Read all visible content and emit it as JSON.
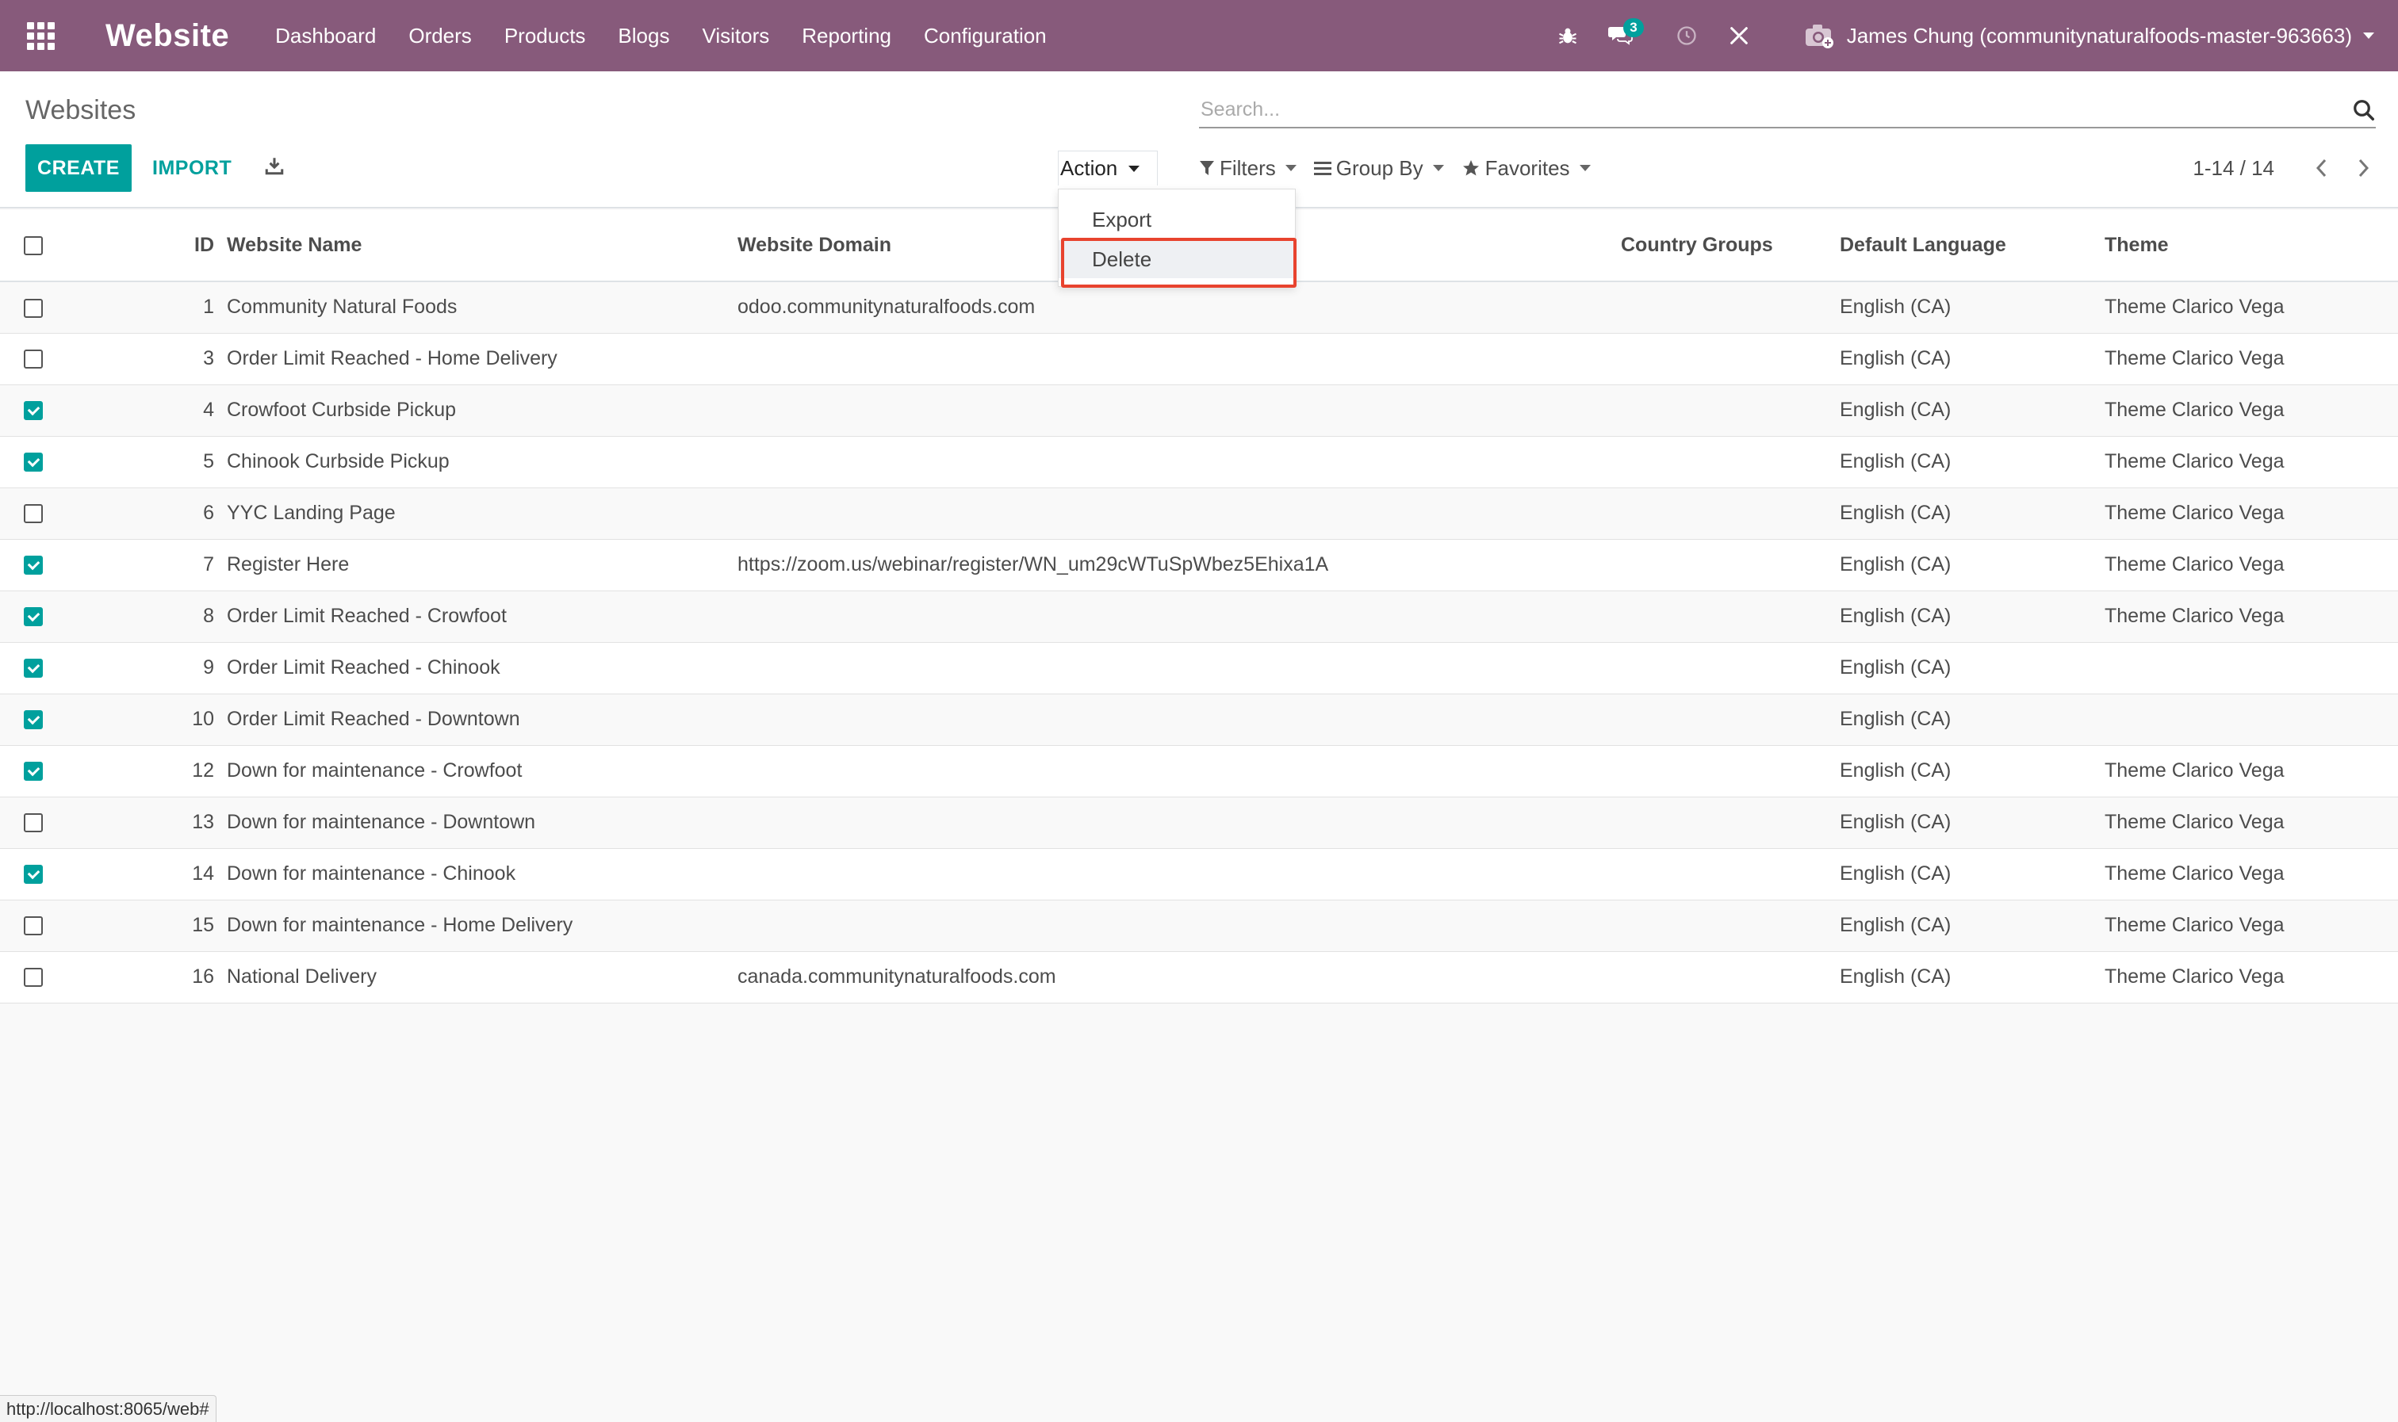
{
  "navbar": {
    "brand": "Website",
    "menu": [
      "Dashboard",
      "Orders",
      "Products",
      "Blogs",
      "Visitors",
      "Reporting",
      "Configuration"
    ],
    "messages_badge": "3",
    "user": "James Chung (communitynaturalfoods-master-963663)",
    "bg_color": "#875a7b"
  },
  "control": {
    "breadcrumb": "Websites",
    "search_placeholder": "Search...",
    "create_label": "CREATE",
    "import_label": "IMPORT",
    "action_label": "Action",
    "filters_label": "Filters",
    "groupby_label": "Group By",
    "favorites_label": "Favorites",
    "pager": "1-14 / 14"
  },
  "action_menu": {
    "items": [
      "Export",
      "Delete"
    ],
    "highlighted": "Delete"
  },
  "table": {
    "columns": [
      "ID",
      "Website Name",
      "Website Domain",
      "Country Groups",
      "Default Language",
      "Theme"
    ],
    "rows": [
      {
        "checked": false,
        "id": "1",
        "name": "Community Natural Foods",
        "domain": "odoo.communitynaturalfoods.com",
        "country": "",
        "lang": "English (CA)",
        "theme": "Theme Clarico Vega"
      },
      {
        "checked": false,
        "id": "3",
        "name": "Order Limit Reached - Home Delivery",
        "domain": "",
        "country": "",
        "lang": "English (CA)",
        "theme": "Theme Clarico Vega"
      },
      {
        "checked": true,
        "id": "4",
        "name": "Crowfoot Curbside Pickup",
        "domain": "",
        "country": "",
        "lang": "English (CA)",
        "theme": "Theme Clarico Vega"
      },
      {
        "checked": true,
        "id": "5",
        "name": "Chinook Curbside Pickup",
        "domain": "",
        "country": "",
        "lang": "English (CA)",
        "theme": "Theme Clarico Vega"
      },
      {
        "checked": false,
        "id": "6",
        "name": "YYC Landing Page",
        "domain": "",
        "country": "",
        "lang": "English (CA)",
        "theme": "Theme Clarico Vega"
      },
      {
        "checked": true,
        "id": "7",
        "name": "Register Here",
        "domain": "https://zoom.us/webinar/register/WN_um29cWTuSpWbez5Ehixa1A",
        "country": "",
        "lang": "English (CA)",
        "theme": "Theme Clarico Vega"
      },
      {
        "checked": true,
        "id": "8",
        "name": "Order Limit Reached - Crowfoot",
        "domain": "",
        "country": "",
        "lang": "English (CA)",
        "theme": "Theme Clarico Vega"
      },
      {
        "checked": true,
        "id": "9",
        "name": "Order Limit Reached - Chinook",
        "domain": "",
        "country": "",
        "lang": "English (CA)",
        "theme": ""
      },
      {
        "checked": true,
        "id": "10",
        "name": "Order Limit Reached - Downtown",
        "domain": "",
        "country": "",
        "lang": "English (CA)",
        "theme": ""
      },
      {
        "checked": true,
        "id": "12",
        "name": "Down for maintenance - Crowfoot",
        "domain": "",
        "country": "",
        "lang": "English (CA)",
        "theme": "Theme Clarico Vega"
      },
      {
        "checked": false,
        "id": "13",
        "name": "Down for maintenance - Downtown",
        "domain": "",
        "country": "",
        "lang": "English (CA)",
        "theme": "Theme Clarico Vega"
      },
      {
        "checked": true,
        "id": "14",
        "name": "Down for maintenance - Chinook",
        "domain": "",
        "country": "",
        "lang": "English (CA)",
        "theme": "Theme Clarico Vega"
      },
      {
        "checked": false,
        "id": "15",
        "name": "Down for maintenance - Home Delivery",
        "domain": "",
        "country": "",
        "lang": "English (CA)",
        "theme": "Theme Clarico Vega"
      },
      {
        "checked": false,
        "id": "16",
        "name": "National Delivery",
        "domain": "canada.communitynaturalfoods.com",
        "country": "",
        "lang": "English (CA)",
        "theme": "Theme Clarico Vega"
      }
    ]
  },
  "status_url": "http://localhost:8065/web#",
  "colors": {
    "accent": "#00a09d",
    "brand": "#875a7b",
    "highlight": "#e8432e"
  }
}
